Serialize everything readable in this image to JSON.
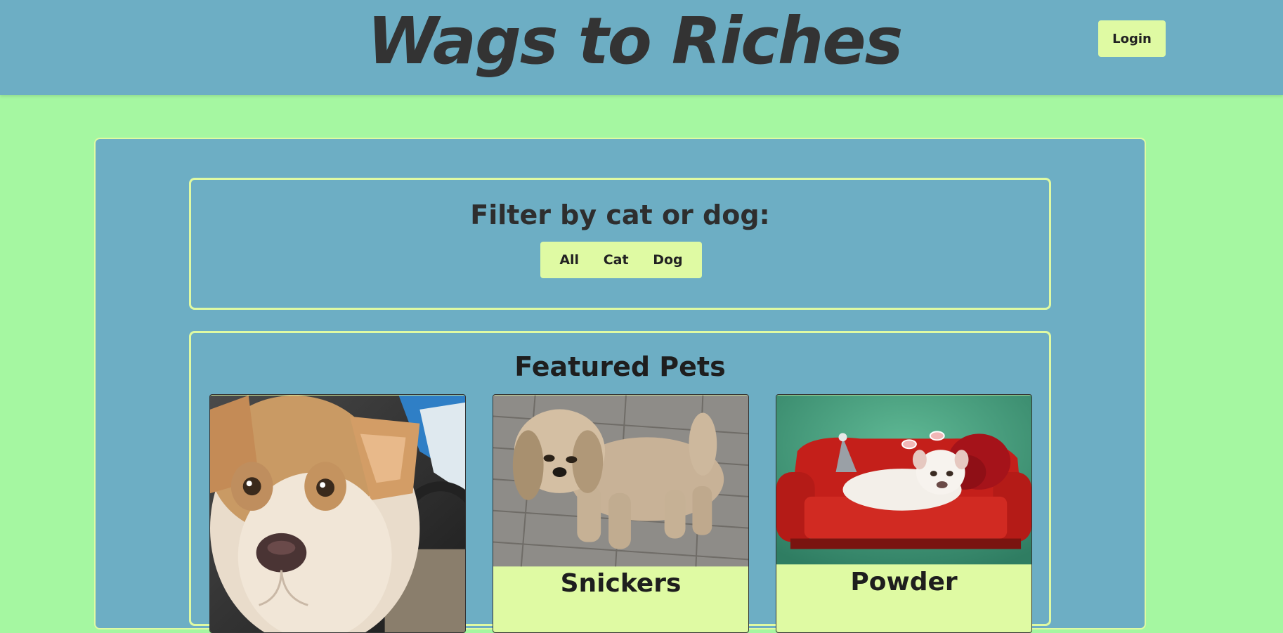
{
  "header": {
    "title": "Wags to Riches",
    "login_label": "Login"
  },
  "filter": {
    "title": "Filter by cat or dog:",
    "options": [
      "All",
      "Cat",
      "Dog"
    ]
  },
  "featured": {
    "title": "Featured Pets",
    "pets": [
      {
        "name": "",
        "photo": "puppy-photo"
      },
      {
        "name": "Snickers",
        "photo": "shih-tzu-photo"
      },
      {
        "name": "Powder",
        "photo": "dog-on-red-couch-photo"
      }
    ]
  },
  "colors": {
    "page_background": "#a5f7a1",
    "panel_blue": "#6daec4",
    "accent_yellow": "#dffaa3",
    "text_dark": "#2e2e2e"
  }
}
